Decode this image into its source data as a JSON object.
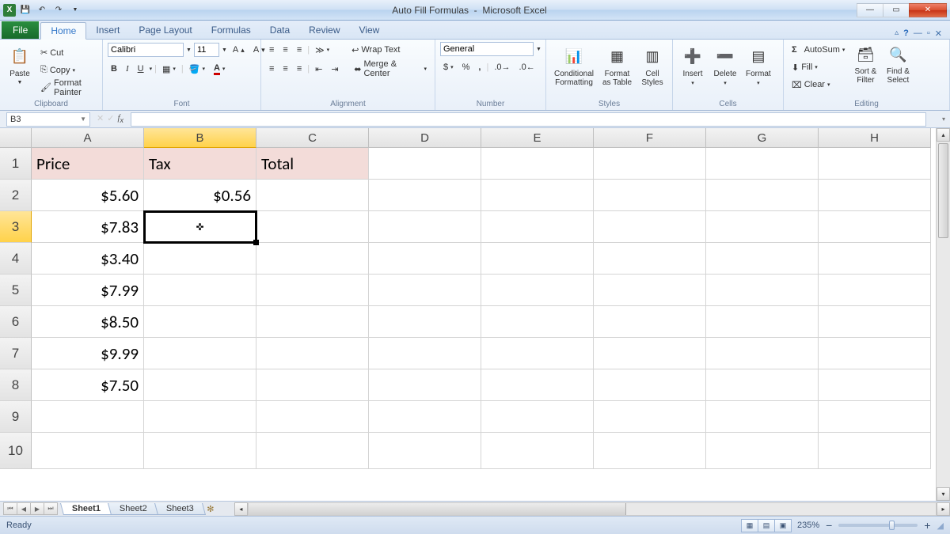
{
  "titlebar": {
    "document_title": "Auto Fill Formulas",
    "app_name": "Microsoft Excel"
  },
  "tabs": {
    "file": "File",
    "list": [
      "Home",
      "Insert",
      "Page Layout",
      "Formulas",
      "Data",
      "Review",
      "View"
    ],
    "active_index": 0
  },
  "ribbon": {
    "clipboard": {
      "paste": "Paste",
      "cut": "Cut",
      "copy": "Copy",
      "format_painter": "Format Painter",
      "group": "Clipboard"
    },
    "font": {
      "name": "Calibri",
      "size": "11",
      "group": "Font",
      "bold": "B",
      "italic": "I",
      "underline": "U"
    },
    "alignment": {
      "wrap": "Wrap Text",
      "merge": "Merge & Center",
      "group": "Alignment"
    },
    "number": {
      "format": "General",
      "group": "Number"
    },
    "styles": {
      "cf": "Conditional\nFormatting",
      "fat": "Format\nas Table",
      "cs": "Cell\nStyles",
      "group": "Styles"
    },
    "cells": {
      "insert": "Insert",
      "delete": "Delete",
      "format": "Format",
      "group": "Cells"
    },
    "editing": {
      "autosum": "AutoSum",
      "fill": "Fill",
      "clear": "Clear",
      "sort": "Sort &\nFilter",
      "find": "Find &\nSelect",
      "group": "Editing"
    }
  },
  "namebox": "B3",
  "columns": [
    "A",
    "B",
    "C",
    "D",
    "E",
    "F",
    "G",
    "H"
  ],
  "rows": [
    "1",
    "2",
    "3",
    "4",
    "5",
    "6",
    "7",
    "8",
    "9",
    "10"
  ],
  "headers": {
    "a": "Price",
    "b": "Tax",
    "c": "Total"
  },
  "data": {
    "a": [
      "$5.60",
      "$7.83",
      "$3.40",
      "$7.99",
      "$8.50",
      "$9.99",
      "$7.50"
    ],
    "b": [
      "$0.56"
    ]
  },
  "active_cell": {
    "col": 1,
    "row": 2
  },
  "sheets": {
    "list": [
      "Sheet1",
      "Sheet2",
      "Sheet3"
    ],
    "active": 0
  },
  "statusbar": {
    "mode": "Ready",
    "zoom": "235%"
  }
}
